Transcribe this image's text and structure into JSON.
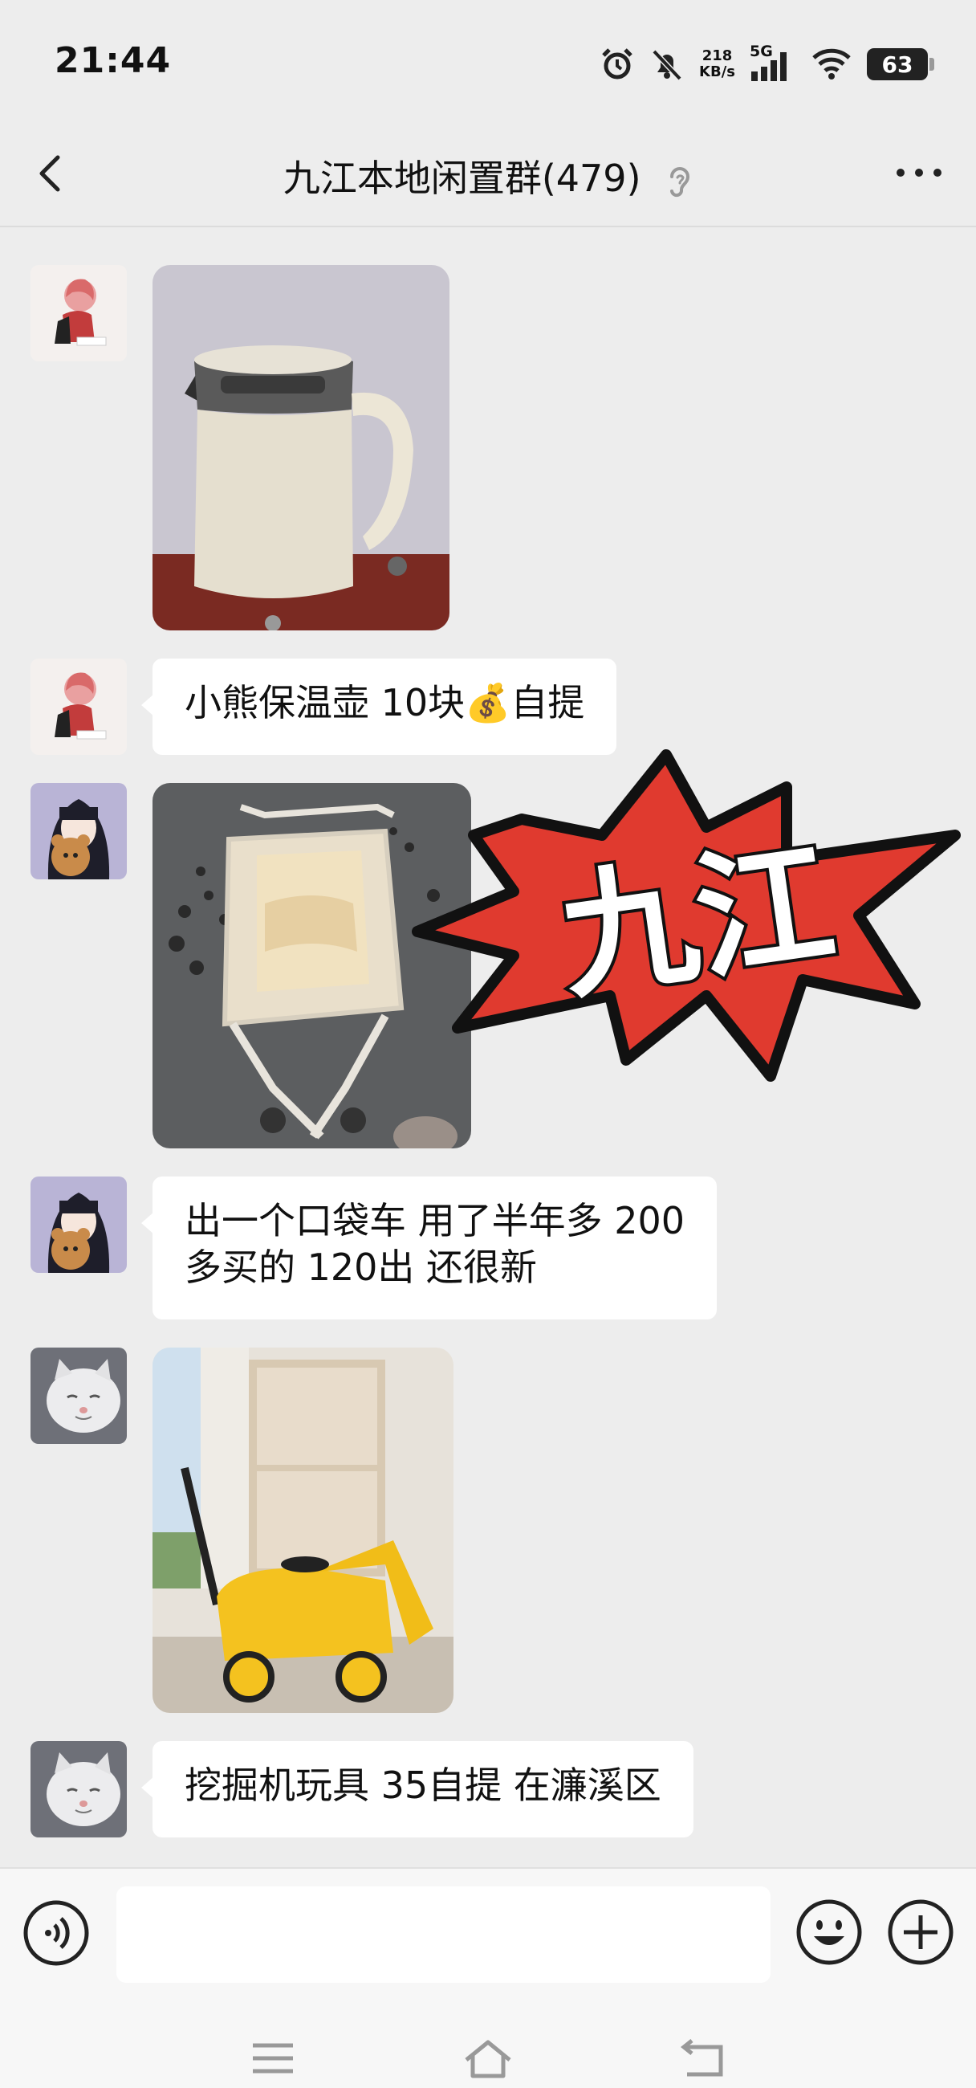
{
  "status_bar": {
    "time": "21:44",
    "net_speed_value": "218",
    "net_speed_unit": "KB/s",
    "network": "5G",
    "battery": "63",
    "icons": [
      "alarm-icon",
      "mute-icon",
      "signal-icon",
      "wifi-icon",
      "battery-icon"
    ]
  },
  "header": {
    "title": "九江本地闲置群(479)",
    "icons": [
      "back-arrow-icon",
      "ear-icon",
      "more-icon"
    ]
  },
  "messages": [
    {
      "type": "image",
      "subject": "kettle-photo",
      "avatar": "avatar-girl-red"
    },
    {
      "type": "text",
      "lines": [
        "小熊保温壶  10块💰自提"
      ],
      "avatar": "avatar-girl-red"
    },
    {
      "type": "image",
      "subject": "stroller-photo",
      "avatar": "avatar-girl-bear"
    },
    {
      "type": "text",
      "lines": [
        "出一个口袋车   用了半年多   200",
        "多买的   120出  还很新"
      ],
      "avatar": "avatar-girl-bear"
    },
    {
      "type": "image",
      "subject": "toy-excavator-photo",
      "avatar": "avatar-cat"
    },
    {
      "type": "text",
      "lines": [
        "挖掘机玩具   35自提    在濂溪区"
      ],
      "avatar": "avatar-cat"
    }
  ],
  "sticker": {
    "text": "九江",
    "colors": {
      "burst": "#e03a2f",
      "outline": "#111111",
      "text": "#ffffff"
    }
  },
  "input": {
    "value": "",
    "icons": [
      "voice-icon",
      "emoji-icon",
      "plus-icon"
    ]
  },
  "nav_bar": {
    "icons": [
      "menu-icon",
      "home-icon",
      "back-icon"
    ]
  },
  "colors": {
    "background": "#ededed",
    "bubble": "#ffffff",
    "input_bar": "#f7f7f7"
  }
}
